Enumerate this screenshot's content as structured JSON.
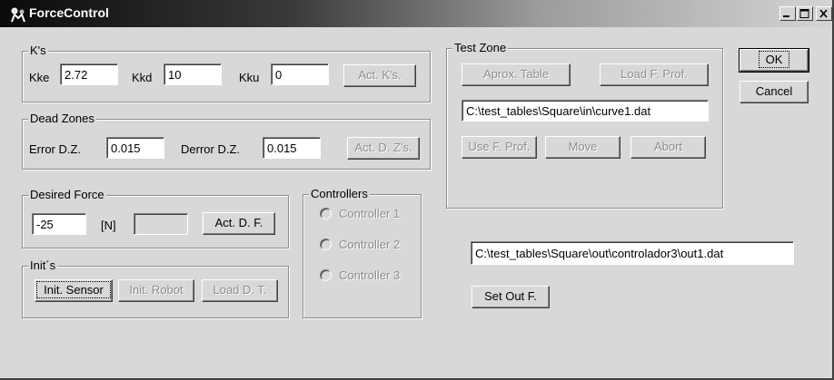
{
  "window": {
    "title": "ForceControl"
  },
  "titlebar_buttons": {
    "minimize_icon": "minimize-icon",
    "maximize_icon": "maximize-icon",
    "close_icon": "close-icon"
  },
  "ks": {
    "legend": "K's",
    "kke_label": "Kke",
    "kke_value": "2.72",
    "kkd_label": "Kkd",
    "kkd_value": "10",
    "kku_label": "Kku",
    "kku_value": "0",
    "act_button": "Act. K's."
  },
  "dead_zones": {
    "legend": "Dead Zones",
    "error_label": "Error D.Z.",
    "error_value": "0.015",
    "derror_label": "Derror D.Z.",
    "derror_value": "0.015",
    "act_button": "Act. D. Z's."
  },
  "desired_force": {
    "legend": "Desired Force",
    "value": "-25",
    "unit": "[N]",
    "readout": "",
    "act_button": "Act. D. F."
  },
  "inits": {
    "legend": "Init´s",
    "init_sensor": "Init. Sensor",
    "init_robot": "Init. Robot",
    "load_dt": "Load D. T."
  },
  "controllers": {
    "legend": "Controllers",
    "options": [
      "Controller 1",
      "Controller 2",
      "Controller 3"
    ]
  },
  "test_zone": {
    "legend": "Test Zone",
    "aprox_table": "Aprox. Table",
    "load_f_prof": "Load F. Prof.",
    "path": "C:\\test_tables\\Square\\in\\curve1.dat",
    "use_f_prof": "Use F. Prof.",
    "move": "Move",
    "abort": "Abort"
  },
  "output": {
    "path": "C:\\test_tables\\Square\\out\\controlador3\\out1.dat",
    "set_button": "Set Out F."
  },
  "dialog": {
    "ok": "OK",
    "cancel": "Cancel"
  }
}
